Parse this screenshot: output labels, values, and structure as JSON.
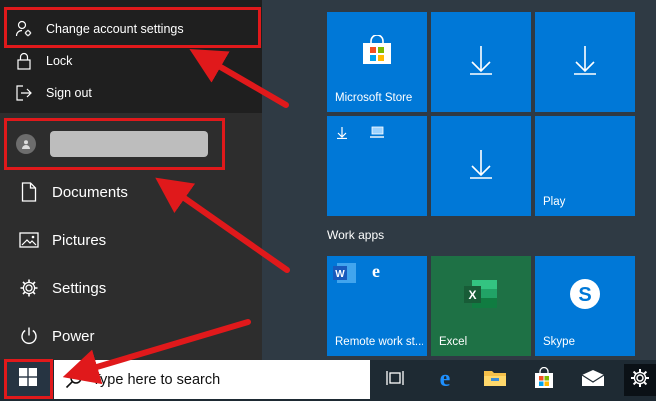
{
  "account_menu": {
    "change_settings": "Change account settings",
    "lock": "Lock",
    "sign_out": "Sign out"
  },
  "nav": {
    "documents": "Documents",
    "pictures": "Pictures",
    "settings": "Settings",
    "power": "Power"
  },
  "tiles": {
    "microsoft_store": "Microsoft Store",
    "play": "Play",
    "remote_work": "Remote work st...",
    "excel": "Excel",
    "skype": "Skype"
  },
  "groups": {
    "work_apps": "Work apps"
  },
  "taskbar": {
    "search_placeholder": "Type here to search"
  },
  "colors": {
    "tile_blue": "#0078d7",
    "excel_green": "#1e7145",
    "annotation_red": "#e0191b",
    "taskbar": "#1e2a33"
  }
}
